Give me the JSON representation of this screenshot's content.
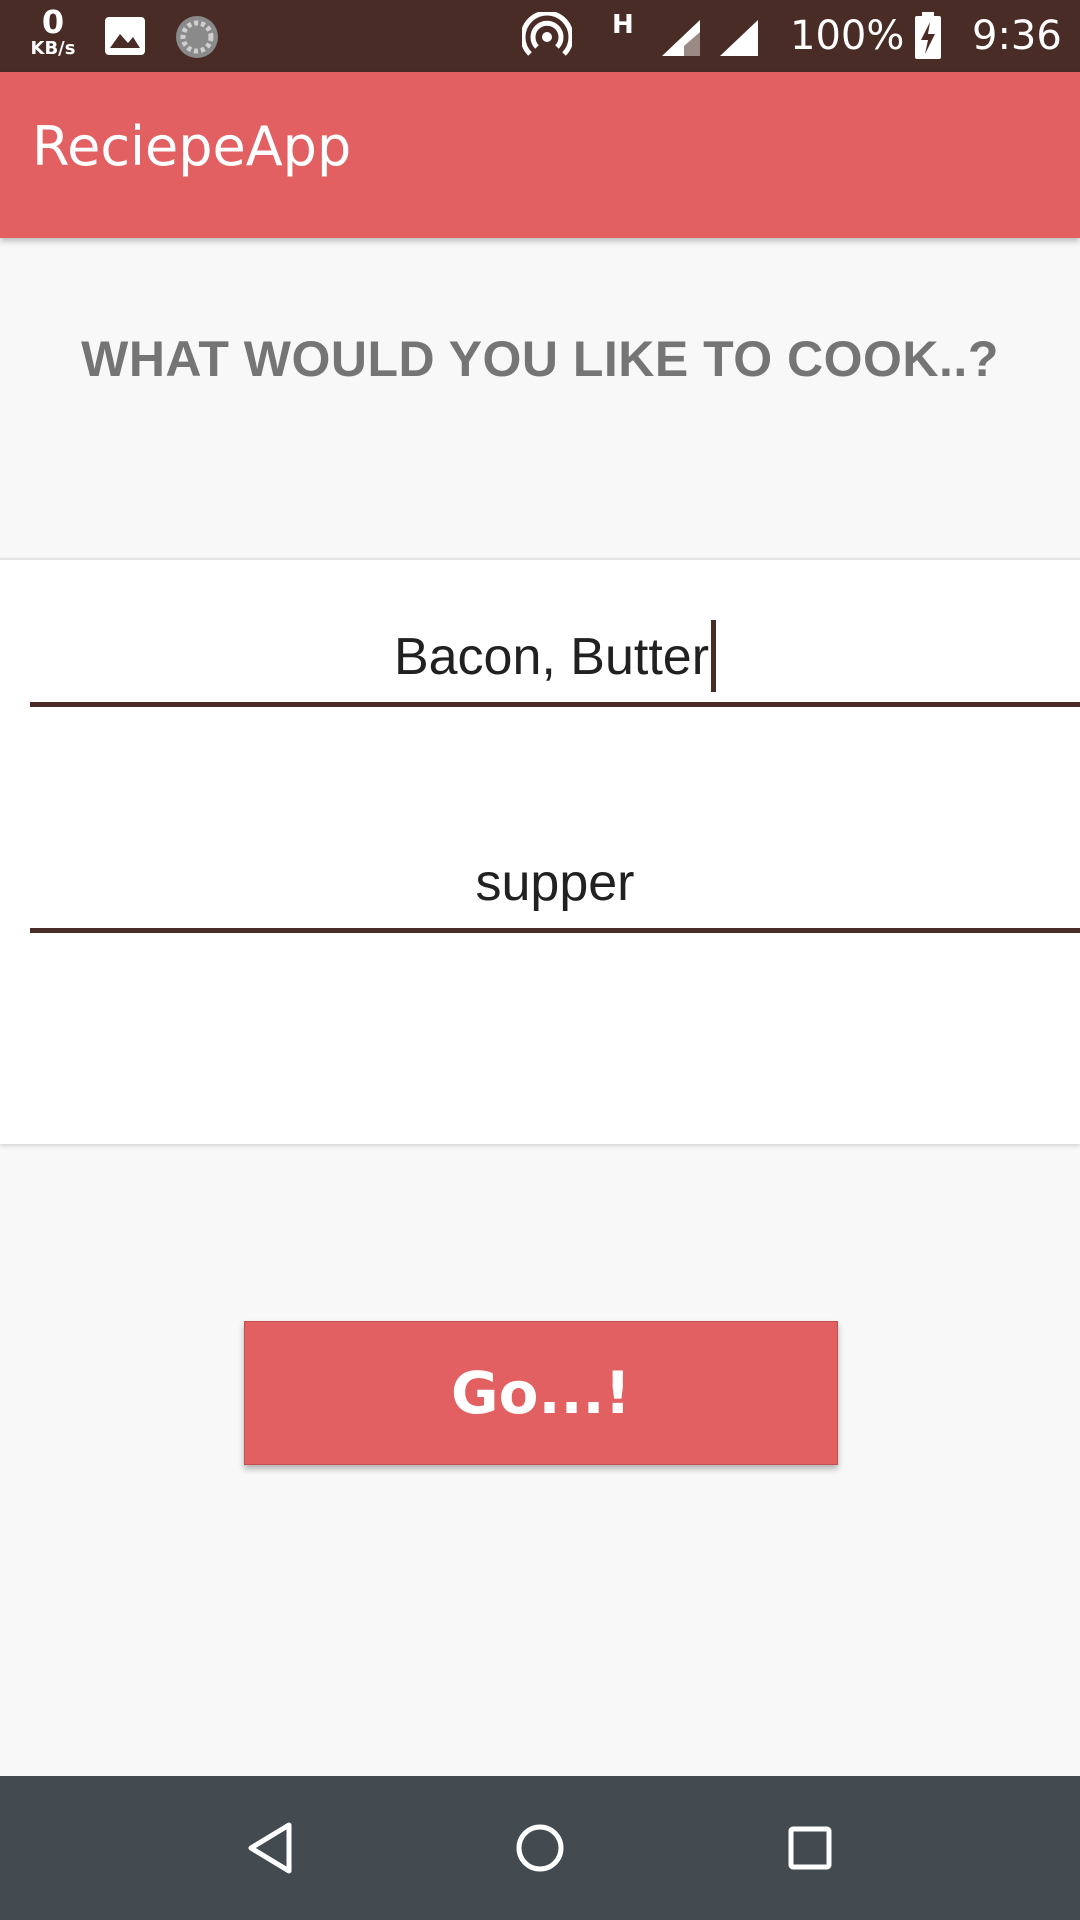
{
  "status_bar": {
    "speed_value": "0",
    "speed_unit": "KB/s",
    "network_type": "H",
    "battery_percent": "100%",
    "time": "9:36",
    "icons": [
      "image-icon",
      "sync-icon",
      "hotspot-icon",
      "signal-icon",
      "signal-icon-2",
      "battery-charging-icon"
    ]
  },
  "app_bar": {
    "title": "ReciepeApp",
    "color": "#e26061"
  },
  "main": {
    "heading": "WHAT WOULD YOU LIKE TO COOK..?",
    "ingredients_value": "Bacon, Butter",
    "meal_value": "supper",
    "go_button_label": "Go...!",
    "accent_color": "#4a2c27"
  },
  "nav_bar": {
    "icons": [
      "back-icon",
      "home-icon",
      "recents-icon"
    ]
  }
}
